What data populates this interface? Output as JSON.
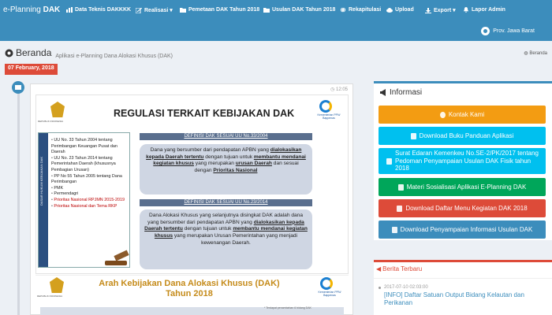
{
  "app": {
    "brand_light": "e-Planning ",
    "brand_bold": "DAK"
  },
  "nav": [
    {
      "label": "Data Teknis DAKKKK",
      "icon": "chart-icon"
    },
    {
      "label": "Realisasi ▾",
      "icon": "edit-icon"
    },
    {
      "label": "Pemetaan DAK Tahun 2018",
      "icon": "folder-icon"
    },
    {
      "label": "Usulan DAK Tahun 2018",
      "icon": "folder-icon"
    },
    {
      "label": "Rekapitulasi",
      "icon": "globe-icon"
    },
    {
      "label": "Upload",
      "icon": "cloud-icon"
    },
    {
      "label": "Export ▾",
      "icon": "download-icon"
    },
    {
      "label": "Lapor Admin",
      "icon": "bell-icon"
    }
  ],
  "user": {
    "name": "Prov. Jawa Barat"
  },
  "header": {
    "title": "Beranda",
    "subtitle": "Aplikasi e-Planning Dana Alokasi Khusus (DAK)",
    "breadcrumb": "Beranda"
  },
  "timeline": {
    "date": "07 February, 2018",
    "time": "12:05",
    "slide1": {
      "title": "REGULASI TERKAIT KEBIJAKAN DAK",
      "emblem_caption": "REPUBLIK INDONESIA",
      "logo_caption": "Kementerian PPN/ Bappenas",
      "side_label": "DASAR HUKUM KEBIJAKAN DAK",
      "regulations": [
        "UU No. 33 Tahun 2004 tentang Perimbangan Keuangan Pusat dan Daerah",
        "UU No. 23 Tahun 2014 tentang Pemerintahan Daerah (khususnya Pembagian Urusan)",
        "PP No 55 Tahun 2005 tentang Dana Perimbangan",
        "PMK",
        "Permendagri",
        "Prioritas Nasional RPJMN 2015-2019",
        "Prioritas Nasional dan Tema RKP"
      ],
      "def1": {
        "heading": "DEFINISI DAK SESUAI UU No.33/2004",
        "text_1": "Dana yang bersumber dari pendapatan APBN yang ",
        "bold_1": "dialokasikan kepada Daerah tertentu",
        "text_2": " dengan tujuan untuk ",
        "bold_2": "membantu mendanai kegiatan khusus",
        "text_3": " yang merupakan ",
        "bold_3": "urusan Daerah",
        "text_4": " dan sesuai dengan ",
        "bold_4": "Prioritas Nasional"
      },
      "def2": {
        "heading": "DEFINISI DAK SESUAI UU No.23/2014",
        "text_1": "Dana Alokasi Khusus yang selanjutnya disingkat DAK adalah dana yang bersumber dari pendapatan APBN yang ",
        "bold_1": "dialokasikan kepada Daerah tertentu",
        "text_2": " dengan tujuan untuk ",
        "bold_2": "membantu mendanai kegiatan khusus",
        "text_3": " yang merupakan Urusan Pemerintahan yang menjadi kewenangan Daerah."
      }
    },
    "slide2": {
      "title_line1": "Arah Kebijakan Dana Alokasi Khusus (DAK)",
      "title_line2": "Tahun 2018",
      "emblem_caption": "REPUBLIK INDONESIA",
      "logo_caption": "Kementerian PPN/ Bappenas",
      "footnote": "* Terdapat penambahan 6 bidang DAK"
    }
  },
  "info": {
    "title": "Informasi",
    "buttons": [
      {
        "label": "Kontak Kami",
        "color": "#f39c12"
      },
      {
        "label": "Download Buku Panduan Aplikasi",
        "color": "#00c0ef"
      },
      {
        "label": "Surat Edaran Kemenkeu No.SE-2/PK/2017 tentang Pedoman Penyampaian Usulan DAK Fisik tahun 2018",
        "color": "#00c0ef"
      },
      {
        "label": "Materi Sosialisasi Aplikasi E-Planning DAK",
        "color": "#00a65a"
      },
      {
        "label": "Download Daftar Menu Kegiatan DAK 2018",
        "color": "#dd4b39"
      },
      {
        "label": "Download Penyampaian Informasi Usulan DAK",
        "color": "#3c8dbc"
      }
    ]
  },
  "berita": {
    "title": "Berita Terbaru",
    "date": "2017-07-10 02:03:00",
    "headline": "[INFO] Daftar Satuan Output Bidang Kelautan dan Perikanan"
  },
  "colors": {
    "navbar": "#3c8dbc",
    "background": "#ecf0f5",
    "badge": "#dd4b39"
  }
}
